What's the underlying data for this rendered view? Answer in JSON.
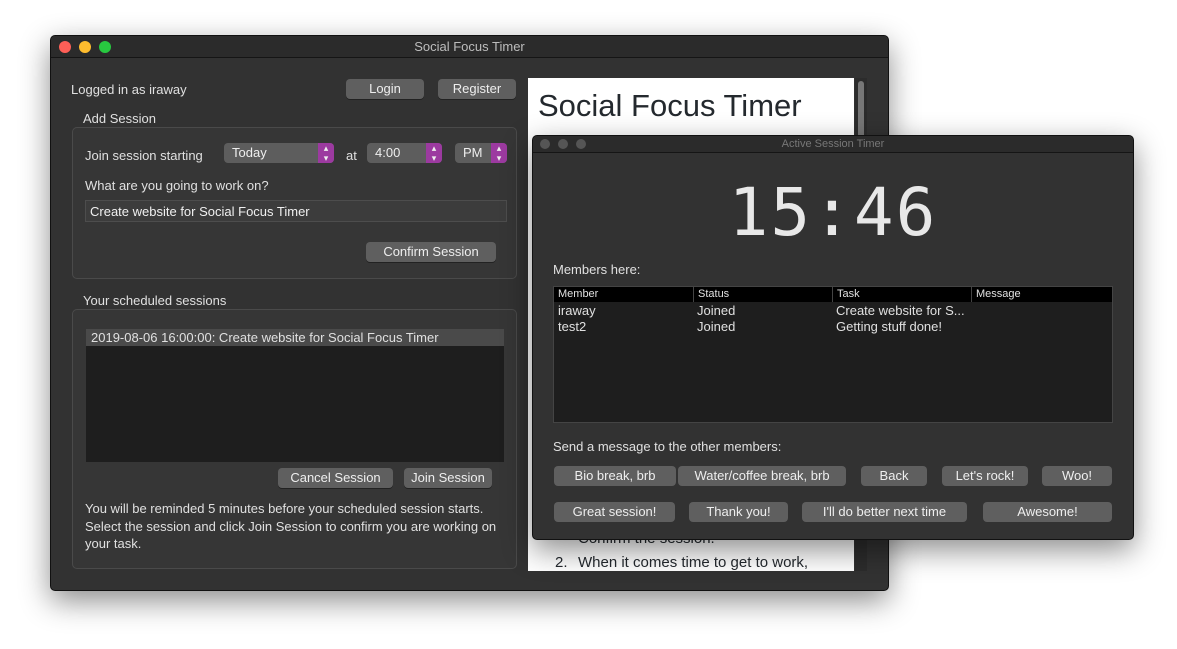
{
  "main_window": {
    "title": "Social Focus Timer",
    "logged_in_text": "Logged in as iraway",
    "login_label": "Login",
    "register_label": "Register",
    "add_session": {
      "heading": "Add Session",
      "join_label": "Join session starting",
      "day_value": "Today",
      "at_label": "at",
      "time_value": "4:00",
      "ampm_value": "PM",
      "work_label": "What are you going to work on?",
      "task_value": "Create website for Social Focus Timer",
      "confirm_label": "Confirm Session"
    },
    "scheduled": {
      "heading": "Your scheduled sessions",
      "items": [
        "2019-08-06 16:00:00: Create website for Social Focus Timer"
      ],
      "cancel_label": "Cancel Session",
      "join_label": "Join Session",
      "note": "You will be reminded 5 minutes before your scheduled session starts. Select the session and click Join Session to confirm you are working on your task."
    },
    "web": {
      "title": "Social Focus Timer",
      "line_partial": "Confirm the session.",
      "item2_num": "2.",
      "item2_text": "When it comes time to get to work,"
    }
  },
  "timer_window": {
    "title": "Active Session Timer",
    "time": "15:46",
    "members_label": "Members here:",
    "columns": [
      "Member",
      "Status",
      "Task",
      "Message"
    ],
    "rows": [
      [
        "iraway",
        "Joined",
        "Create website for S...",
        ""
      ],
      [
        "test2",
        "Joined",
        "Getting stuff done!",
        ""
      ]
    ],
    "send_label": "Send a message to the other members:",
    "messages_row1": [
      "Bio break, brb",
      "Water/coffee break, brb",
      "Back",
      "Let's rock!",
      "Woo!"
    ],
    "messages_row2": [
      "Great session!",
      "Thank you!",
      "I'll do better next time",
      "Awesome!"
    ]
  },
  "colors": {
    "accent": "#9c3aa0",
    "close": "#fe5f57",
    "minimize": "#febc2e",
    "zoom": "#28c840"
  }
}
